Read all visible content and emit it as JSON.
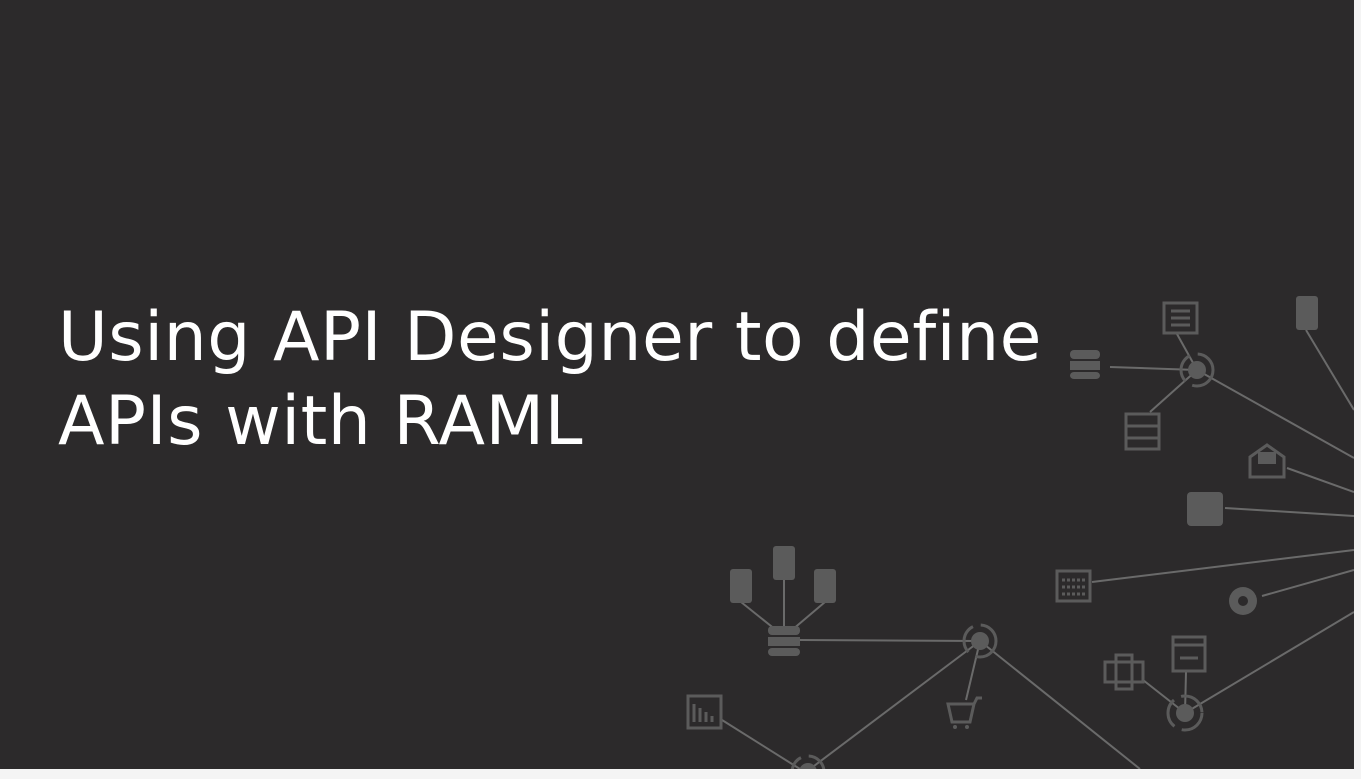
{
  "slide": {
    "title_lines": [
      "Using API Designer to define",
      "APIs with RAML"
    ],
    "background_color": "#2c2a2b",
    "text_color": "#ffffff",
    "diagram_icons": [
      "document-icon",
      "phone-icon",
      "database-icon",
      "server-icon",
      "envelope-icon",
      "tablet-icon",
      "calendar-icon",
      "gear-icon",
      "fax-icon",
      "browser-window-icon",
      "cart-icon",
      "bar-chart-icon",
      "hub-icon"
    ]
  }
}
